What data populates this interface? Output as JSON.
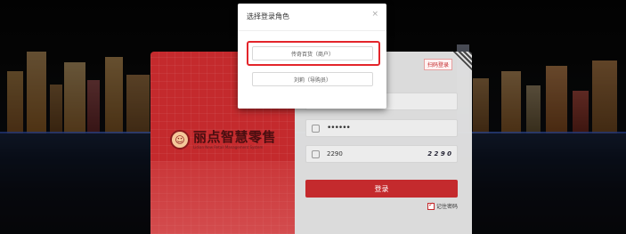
{
  "modal": {
    "title": "选择登录角色",
    "close_glyph": "×",
    "roles": [
      {
        "label": "传奇百货（商户）",
        "selected": true
      },
      {
        "label": "刘莉（导购员）",
        "selected": false
      }
    ]
  },
  "brand": {
    "name": "丽点智慧零售",
    "subtitle": "Lidian New Retail Management System",
    "logo_glyph": "☺"
  },
  "login": {
    "scan_label": "扫码登录",
    "password_mask": "••••••",
    "captcha_value": "2290",
    "captcha_image_text": "2 2 9 0",
    "submit_label": "登录",
    "remember_label": "记住密码"
  },
  "colors": {
    "accent": "#c42a2d",
    "highlight": "#e3252b"
  }
}
